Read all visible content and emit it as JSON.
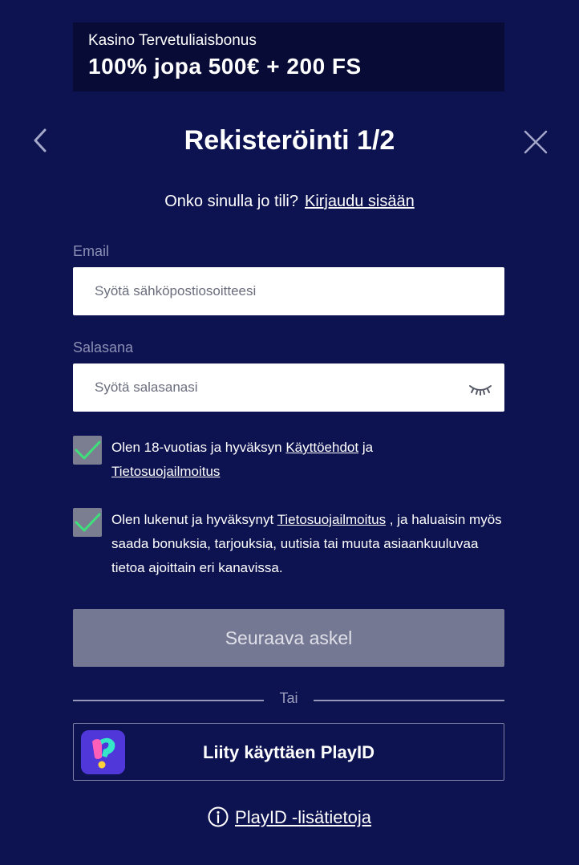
{
  "promo": {
    "subtitle": "Kasino Tervetuliaisbonus",
    "headline": "100% jopa 500€ + 200 FS"
  },
  "header": {
    "title": "Rekisteröinti 1/2",
    "back_icon": "chevron-left-icon",
    "close_icon": "close-icon"
  },
  "login": {
    "question": "Onko sinulla jo tili?",
    "link": "Kirjaudu sisään"
  },
  "email": {
    "label": "Email",
    "placeholder": "Syötä sähköpostiosoitteesi",
    "value": ""
  },
  "password": {
    "label": "Salasana",
    "placeholder": "Syötä salasanasi",
    "value": "",
    "toggle_icon": "eye-closed-icon"
  },
  "terms": {
    "checked": true,
    "text_before": "Olen 18-vuotias ja hyväksyn ",
    "link1": "Käyttöehdot",
    "text_middle": " ja ",
    "link2": "Tietosuojailmoitus"
  },
  "marketing": {
    "checked": true,
    "text_before": "Olen lukenut ja hyväksynyt ",
    "link": "Tietosuojailmoitus",
    "text_after": " , ja haluaisin myös saada bonuksia, tarjouksia, uutisia tai muuta asiaankuuluvaa tietoa ajoittain eri kanavissa."
  },
  "next_button": {
    "label": "Seuraava askel"
  },
  "divider": {
    "label": "Tai"
  },
  "playid": {
    "label": "Liity käyttäen PlayID",
    "info_link": "PlayID -lisätietoja",
    "info_icon": "info-icon"
  },
  "colors": {
    "background": "#0d1250",
    "promo_background": "#080b36",
    "checkmark": "#3ee07a",
    "button_disabled": "#757892"
  }
}
